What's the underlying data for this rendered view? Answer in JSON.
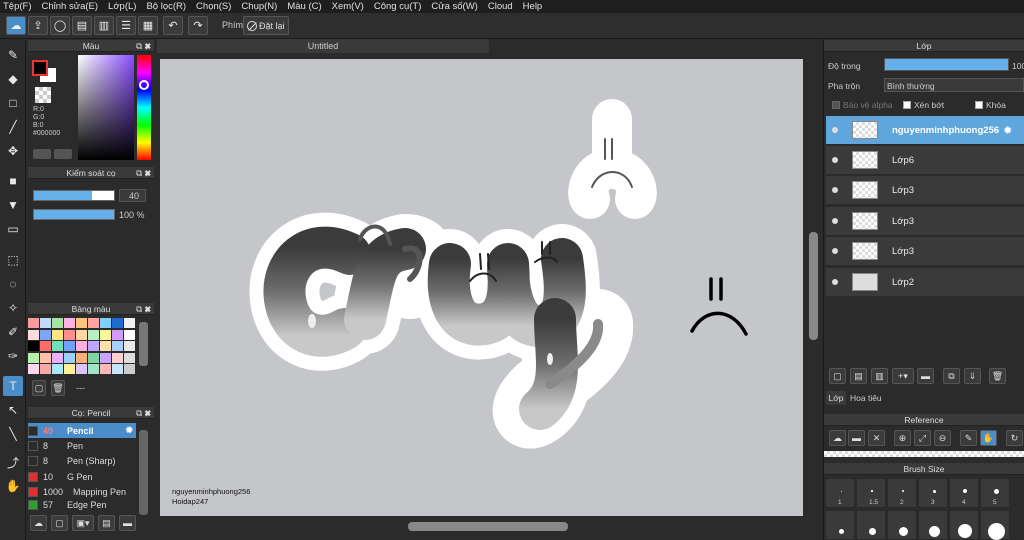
{
  "menu": [
    "Tệp(F)",
    "Chỉnh sửa(E)",
    "Lớp(L)",
    "Bộ lọc(R)",
    "Chọn(S)",
    "Chụp(N)",
    "Màu (C)",
    "Xem(V)",
    "Công cụ(T)",
    "Cửa số(W)",
    "Cloud",
    "Help"
  ],
  "toolbar": {
    "phim_label": "Phím",
    "reset_label": "Đặt lại"
  },
  "color_panel": {
    "title": "Màu",
    "r": "R:0",
    "g": "G:0",
    "b": "B:0",
    "hex": "#000000"
  },
  "brush_control": {
    "title": "Kiểm soát cọ",
    "size_value": "40",
    "opacity_value": "100 %",
    "size_fill": 0.72,
    "opacity_fill": 1.0
  },
  "palette_panel": {
    "title": "Bảng màu",
    "footer": "---",
    "colors": [
      "#ff9a9a",
      "#c0d9ff",
      "#a6e3a1",
      "#ffb0e6",
      "#ffc67a",
      "#ffa3a3",
      "#7fd0ff",
      "#1e6bd6",
      "#f0f0f0",
      "#ffdada",
      "#7aa6ff",
      "#ffe680",
      "#ff8f8f",
      "#ffd7a3",
      "#b5f0c0",
      "#fff59a",
      "#d29bff",
      "#ffffff",
      "#000000",
      "#ff6d6d",
      "#6fe0b8",
      "#73a0ff",
      "#ffb2d5",
      "#bba7ff",
      "#ffe0a8",
      "#aacfff",
      "#e8e8e8",
      "#b7f0a8",
      "#ffc1a8",
      "#e8b0ff",
      "#9ad0ff",
      "#ffaf7a",
      "#7dd6a0",
      "#c8a6ff",
      "#ffd0d0",
      "#dddddd",
      "#ffd6f0",
      "#f7a8a8",
      "#a7e8ff",
      "#ffef9a",
      "#d9c4ff",
      "#9fe3c4",
      "#ffb8b8",
      "#c6e5ff",
      "#cccccc"
    ]
  },
  "brush_panel": {
    "title": "Cọ: Pencil",
    "items": [
      {
        "size": "40",
        "name": "Pencil",
        "color": "#2b2b2b"
      },
      {
        "size": "8",
        "name": "Pen",
        "color": "#2b2b2b"
      },
      {
        "size": "8",
        "name": "Pen (Sharp)",
        "color": "#2b2b2b"
      },
      {
        "size": "10",
        "name": "G Pen",
        "color": "#e03030"
      },
      {
        "size": "1000",
        "name": "Mapping Pen",
        "color": "#e03030"
      },
      {
        "size": "57",
        "name": "Edge Pen",
        "color": "#2ca02c"
      }
    ]
  },
  "document": {
    "tab_title": "Untitled",
    "credit_line1": "nguyenminhphuong256",
    "credit_line2": "Hoidap247"
  },
  "layers_panel": {
    "title": "Lớp",
    "opacity_label": "Độ trong",
    "opacity_value": "100",
    "blend_label": "Pha trộn",
    "blend_value": "Bình thường",
    "protect_alpha": "Bảo vệ alpha",
    "clipping": "Xén bớt",
    "lock": "Khóa",
    "layers": [
      {
        "name": "nguyenminhphuong256",
        "selected": true
      },
      {
        "name": "Lớp6",
        "selected": false
      },
      {
        "name": "Lớp3",
        "selected": false
      },
      {
        "name": "Lớp3",
        "selected": false
      },
      {
        "name": "Lớp3",
        "selected": false
      },
      {
        "name": "Lớp2",
        "selected": false
      }
    ],
    "tabs": [
      "Lớp",
      "Hoa tiêu"
    ]
  },
  "reference_panel": {
    "title": "Reference"
  },
  "brush_size_panel": {
    "title": "Brush Size",
    "labels": [
      "1",
      "1.5",
      "2",
      "3",
      "4",
      "5"
    ]
  }
}
